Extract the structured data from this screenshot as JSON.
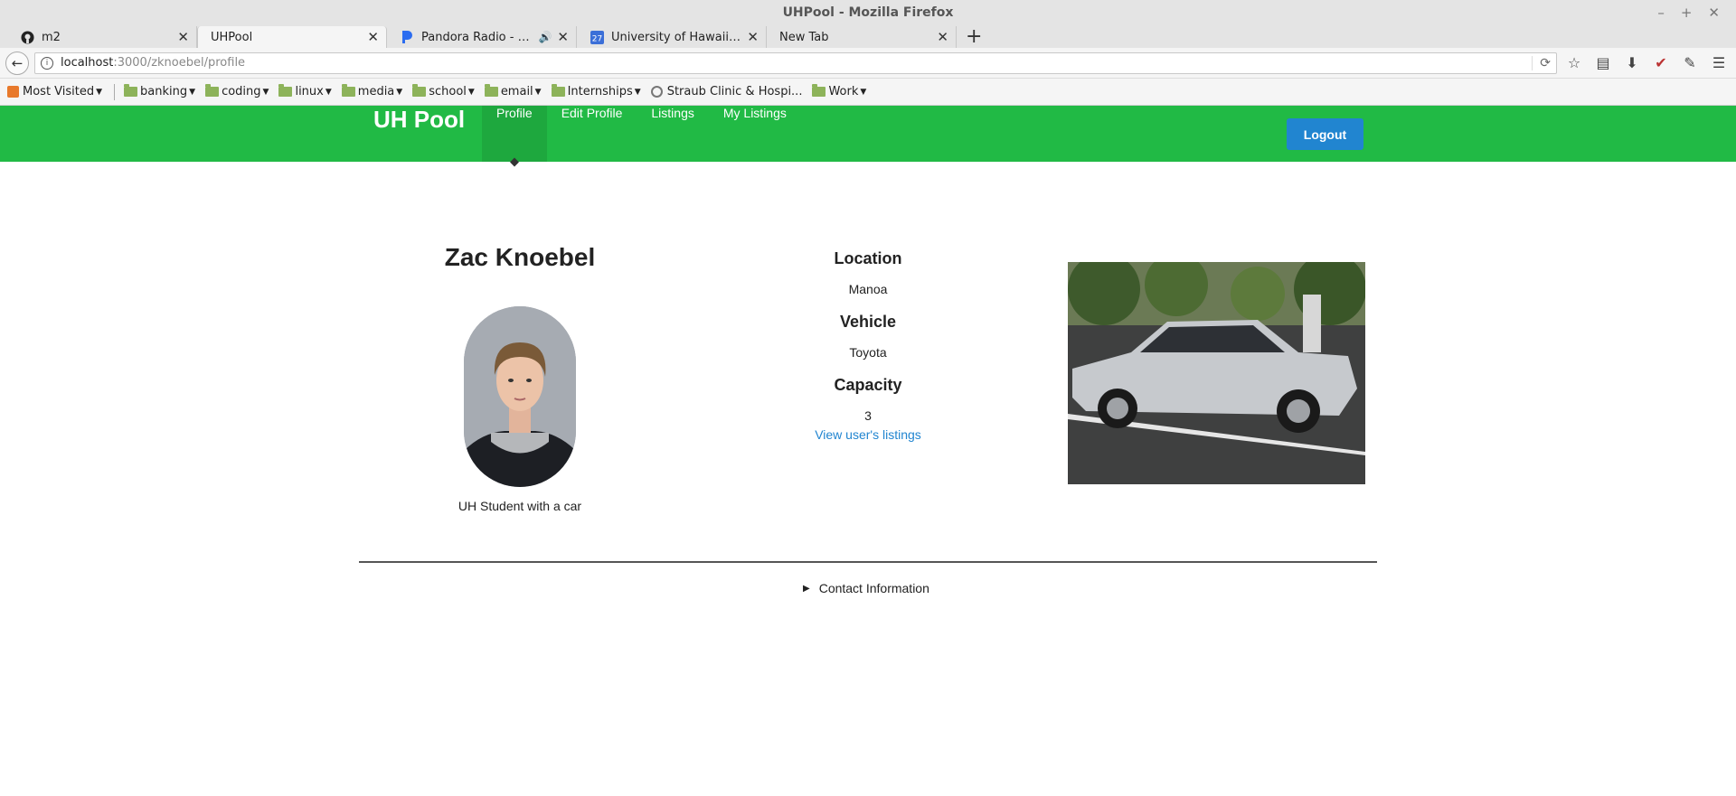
{
  "window": {
    "title": "UHPool - Mozilla Firefox"
  },
  "tabs": [
    {
      "title": "m2",
      "icon": "github-icon"
    },
    {
      "title": "UHPool",
      "icon": "",
      "active": true
    },
    {
      "title": "Pandora Radio - Liste...",
      "icon": "pandora-icon",
      "audio": true
    },
    {
      "title": "University of Hawaii - Cal...",
      "icon": "calendar-icon",
      "badge": "27"
    },
    {
      "title": "New Tab",
      "icon": ""
    }
  ],
  "url": {
    "host": "localhost",
    "path": ":3000/zknoebel/profile"
  },
  "bookmarks": {
    "most_visited": "Most Visited",
    "folders": [
      "banking",
      "coding",
      "linux",
      "media",
      "school",
      "email",
      "Internships"
    ],
    "straub": "Straub Clinic & Hospi...",
    "work": "Work"
  },
  "site": {
    "brand": "UH Pool",
    "menu": [
      "Profile",
      "Edit Profile",
      "Listings",
      "My Listings"
    ],
    "logout": "Logout"
  },
  "profile": {
    "name": "Zac Knoebel",
    "bio": "UH Student with a car",
    "location_label": "Location",
    "location": "Manoa",
    "vehicle_label": "Vehicle",
    "vehicle": "Toyota",
    "capacity_label": "Capacity",
    "capacity": "3",
    "listings_link": "View user's listings",
    "contact": "Contact Information"
  },
  "colors": {
    "nav_green": "#21ba45",
    "logout_blue": "#2185d0",
    "link_blue": "#2185d0"
  }
}
